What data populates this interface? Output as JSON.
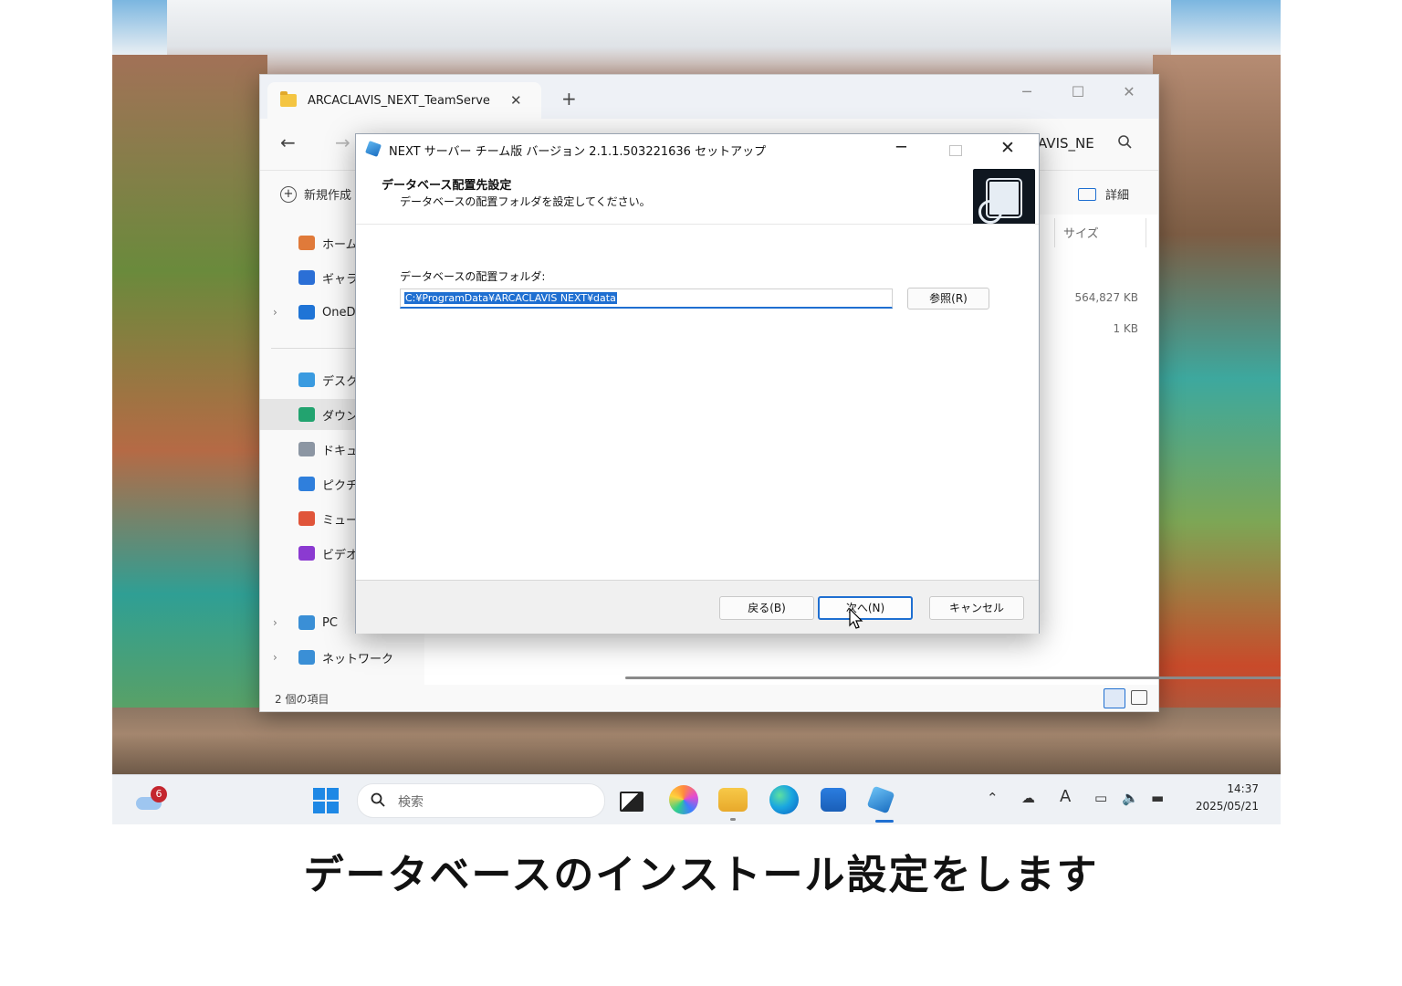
{
  "explorer": {
    "tab_label": "ARCACLAVIS_NEXT_TeamServe",
    "tab_close": "✕",
    "new_tab": "+",
    "window_min": "─",
    "window_max": "☐",
    "window_close": "✕",
    "back": "←",
    "forward": "→",
    "address_tail": "AVIS_NE",
    "new_label": "新規作成",
    "details_label": "詳細",
    "sidebar": [
      {
        "label": "ホーム",
        "icon": "home-icon",
        "color": "#e07a3a"
      },
      {
        "label": "ギャラリー",
        "icon": "gallery-icon",
        "color": "#2b6fd6"
      },
      {
        "label": "OneDrive",
        "icon": "cloud-icon",
        "color": "#1f74d6",
        "expandable": true
      },
      {
        "label": "デスクトップ",
        "icon": "desktop-icon",
        "color": "#3a9be0"
      },
      {
        "label": "ダウンロード",
        "icon": "download-icon",
        "color": "#22a36f",
        "selected": true
      },
      {
        "label": "ドキュメント",
        "icon": "document-icon",
        "color": "#8c96a3"
      },
      {
        "label": "ピクチャ",
        "icon": "pictures-icon",
        "color": "#2f7fdc"
      },
      {
        "label": "ミュージック",
        "icon": "music-icon",
        "color": "#e0553a"
      },
      {
        "label": "ビデオ",
        "icon": "video-icon",
        "color": "#8b3ad1"
      },
      {
        "label": "PC",
        "icon": "pc-icon",
        "color": "#3a8fd6",
        "expandable": true
      },
      {
        "label": "ネットワーク",
        "icon": "network-icon",
        "color": "#3a8fd6",
        "expandable": true
      }
    ],
    "columns": {
      "size": "サイズ"
    },
    "sizes": [
      "564,827 KB",
      "1 KB"
    ],
    "status_count": "2 個の項目"
  },
  "dialog": {
    "title": "NEXT サーバー チーム版 バージョン 2.1.1.503221636 セットアップ",
    "heading": "データベース配置先設定",
    "subheading": "データベースの配置フォルダを設定してください。",
    "folder_label": "データベースの配置フォルダ:",
    "folder_path": "C:¥ProgramData¥ARCACLAVIS NEXT¥data",
    "browse_button": "参照(R)",
    "back_button": "戻る(B)",
    "next_button": "次へ(N)",
    "cancel_button": "キャンセル",
    "minimize": "─",
    "close": "✕"
  },
  "taskbar": {
    "weather_badge": "6",
    "search_placeholder": "検索",
    "time": "14:37",
    "date": "2025/05/21",
    "ime": "A"
  },
  "caption": "データベースのインストール設定をします"
}
